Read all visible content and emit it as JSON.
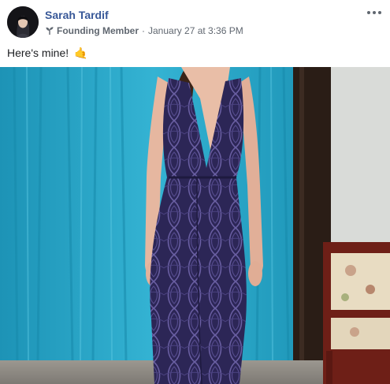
{
  "post": {
    "author_name": "Sarah Tardif",
    "badge_label": "Founding Member",
    "separator": "·",
    "timestamp": "January 27 at 3:36 PM",
    "text": "Here's mine!",
    "emoji": "🤙"
  },
  "icons": {
    "avatar": "profile-photo",
    "badge": "sprout-icon",
    "more": "more-options-icon"
  },
  "colors": {
    "author_link": "#385898",
    "meta_text": "#606770",
    "curtain": "#29a5c6",
    "dress": "#2a2450"
  }
}
